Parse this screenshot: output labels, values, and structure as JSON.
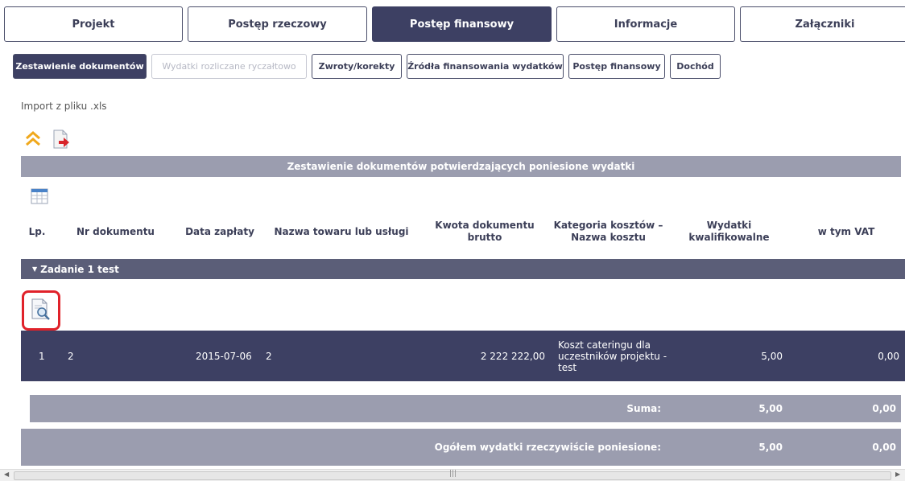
{
  "main_tabs": [
    {
      "label": "Projekt",
      "active": false
    },
    {
      "label": "Postęp rzeczowy",
      "active": false
    },
    {
      "label": "Postęp finansowy",
      "active": true
    },
    {
      "label": "Informacje",
      "active": false
    },
    {
      "label": "Załączniki",
      "active": false
    }
  ],
  "sub_tabs": [
    {
      "label": "Zestawienie dokumentów",
      "state": "active"
    },
    {
      "label": "Wydatki rozliczane ryczałtowo",
      "state": "disabled"
    },
    {
      "label": "Zwroty/korekty",
      "state": "normal"
    },
    {
      "label": "Źródła finansowania wydatków",
      "state": "normal"
    },
    {
      "label": "Postęp finansowy",
      "state": "normal"
    },
    {
      "label": "Dochód",
      "state": "normal"
    }
  ],
  "import_link": "Import z pliku .xls",
  "toolbar_icons": [
    "collapse-up-icon",
    "export-document-icon",
    "table-icon",
    "document-preview-icon"
  ],
  "section_title": "Zestawienie dokumentów potwierdzających poniesione wydatki",
  "columns": [
    "Lp.",
    "Nr dokumentu",
    "Data zapłaty",
    "Nazwa towaru lub usługi",
    "Kwota dokumentu brutto",
    "Kategoria kosztów – Nazwa kosztu",
    "Wydatki kwalifikowalne",
    "w tym VAT"
  ],
  "task": {
    "label": "Zadanie 1 test"
  },
  "rows": [
    {
      "lp": "1",
      "nr_dokumentu": "2",
      "data_zaplaty": "2015-07-06",
      "nazwa": "2",
      "kwota_brutto": "2 222 222,00",
      "kategoria": "Koszt cateringu dla uczestników projektu - test",
      "wydatki_kwalifikowalne": "5,00",
      "vat": "0,00"
    }
  ],
  "sum": {
    "label": "Suma:",
    "kwalifikowalne": "5,00",
    "vat": "0,00"
  },
  "total": {
    "label": "Ogółem wydatki rzeczywiście poniesione:",
    "kwalifikowalne": "5,00",
    "vat": "0,00"
  },
  "colors": {
    "dark": "#3d4063",
    "task_bar": "#5b5e78",
    "grey_bar": "#9b9daf",
    "highlight": "#e0222a"
  }
}
